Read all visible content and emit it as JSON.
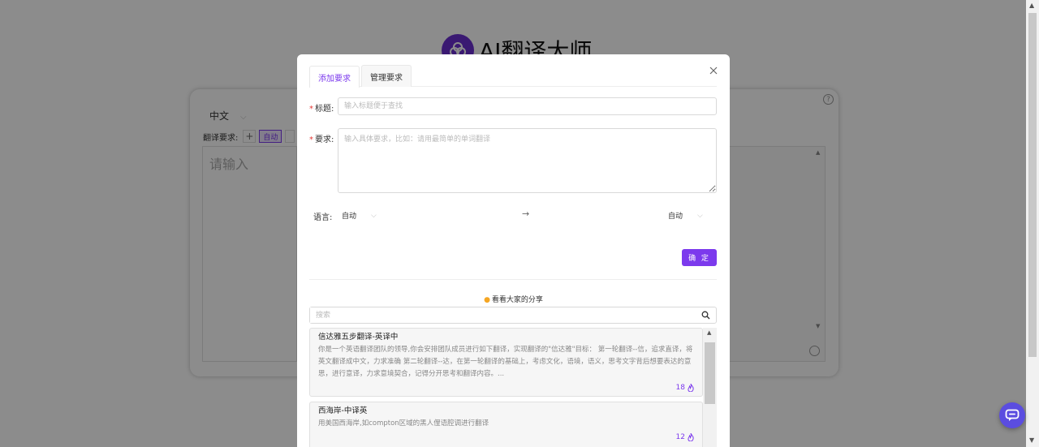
{
  "background": {
    "app_title": "AI翻译大师",
    "source_lang": "中文",
    "requirement_label": "翻译要求:",
    "requirement_add": "+",
    "requirement_auto": "自动",
    "input_placeholder": "请输入"
  },
  "modal": {
    "tabs": [
      {
        "label": "添加要求",
        "active": true
      },
      {
        "label": "管理要求",
        "active": false
      }
    ],
    "title_field": {
      "label": "标题:",
      "placeholder": "输入标题便于查找",
      "value": ""
    },
    "requirement_field": {
      "label": "要求:",
      "placeholder": "输入具体要求，比如：请用最简单的单词翻译",
      "value": ""
    },
    "language": {
      "label": "语言:",
      "from": "自动",
      "to": "自动"
    },
    "confirm_label": "确 定",
    "share_title": "看看大家的分享",
    "search": {
      "placeholder": "搜索",
      "value": ""
    },
    "shared_items": [
      {
        "title": "信达雅五步翻译-英译中",
        "description": "你是一个英语翻译团队的领导,你会安排团队成员进行如下翻译，实现翻译的\"信达雅\"目标： 第一轮翻译--信，追求直译，将英文翻译成中文，力求准确 第二轮翻译--达，在第一轮翻译的基础上，考虑文化，语境，语义，思考文字背后想要表达的意思，进行意译，力求意境契合，记得分开思考和翻译内容。...",
        "count": "18"
      },
      {
        "title": "西海岸-中译英",
        "description": "用美国西海岸,如compton区域的黑人俚语腔调进行翻译",
        "count": "12"
      }
    ]
  },
  "colors": {
    "accent": "#7c3aed",
    "required_star": "#e53935",
    "flame": "#f5a623",
    "chat_button": "#5b4de0"
  },
  "icons": {
    "close": "close-icon",
    "search": "search-icon",
    "arrow": "arrow-right-icon",
    "fire": "fire-icon",
    "chat": "chat-icon"
  }
}
